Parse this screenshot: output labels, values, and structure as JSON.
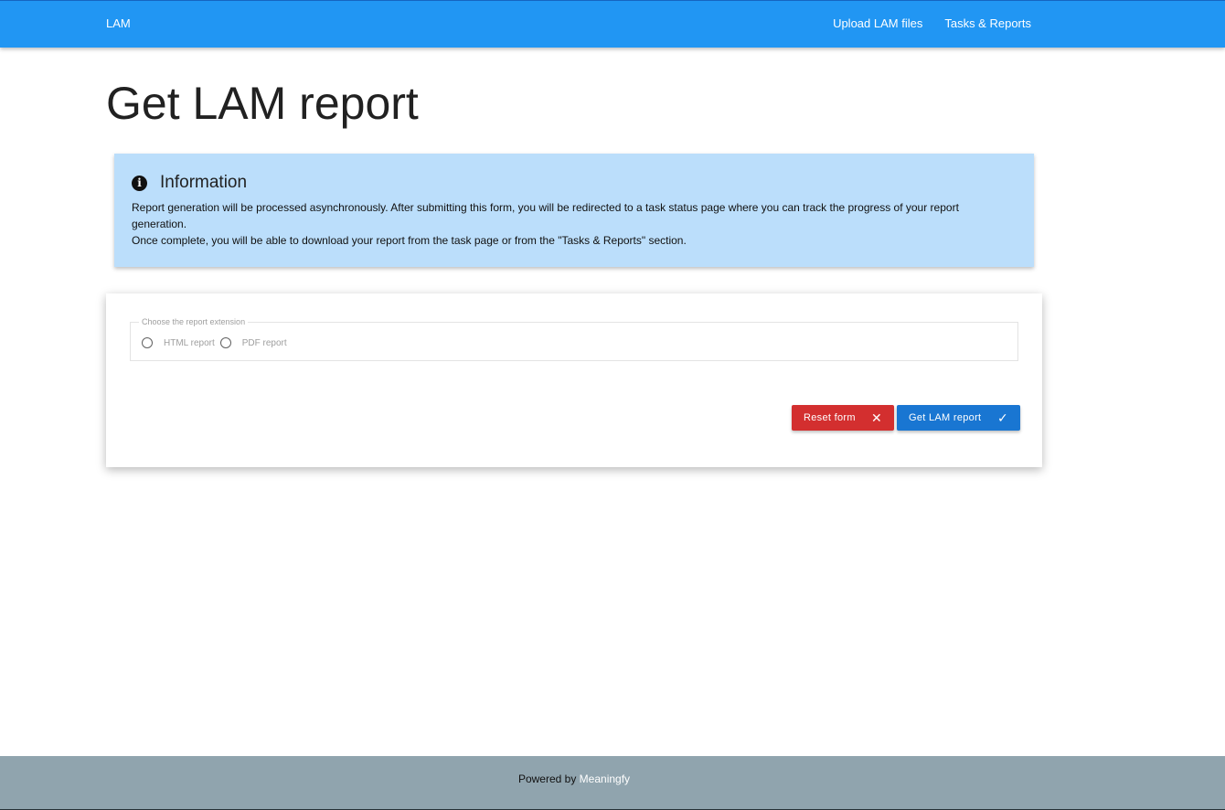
{
  "navbar": {
    "brand": "LAM",
    "links": [
      "Upload LAM files",
      "Tasks & Reports"
    ]
  },
  "page": {
    "title": "Get LAM report"
  },
  "info": {
    "icon": "info-circle-icon",
    "title": "Information",
    "line1": "Report generation will be processed asynchronously. After submitting this form, you will be redirected to a task status page where you can track the progress of your report generation.",
    "line2": "Once complete, you will be able to download your report from the task page or from the \"Tasks & Reports\" section."
  },
  "form": {
    "legend": "Choose the report extension",
    "options": [
      "HTML report",
      "PDF report"
    ],
    "reset_label": "Reset form",
    "reset_icon": "close-icon",
    "submit_label": "Get LAM report",
    "submit_icon": "check-icon"
  },
  "footer": {
    "prefix": "Powered by",
    "link": "Meaningfy"
  },
  "colors": {
    "navbar": "#2196f3",
    "info_bg": "#bbdefb",
    "reset": "#d32f2f",
    "submit": "#1976d2",
    "footer": "#90a4ae"
  }
}
